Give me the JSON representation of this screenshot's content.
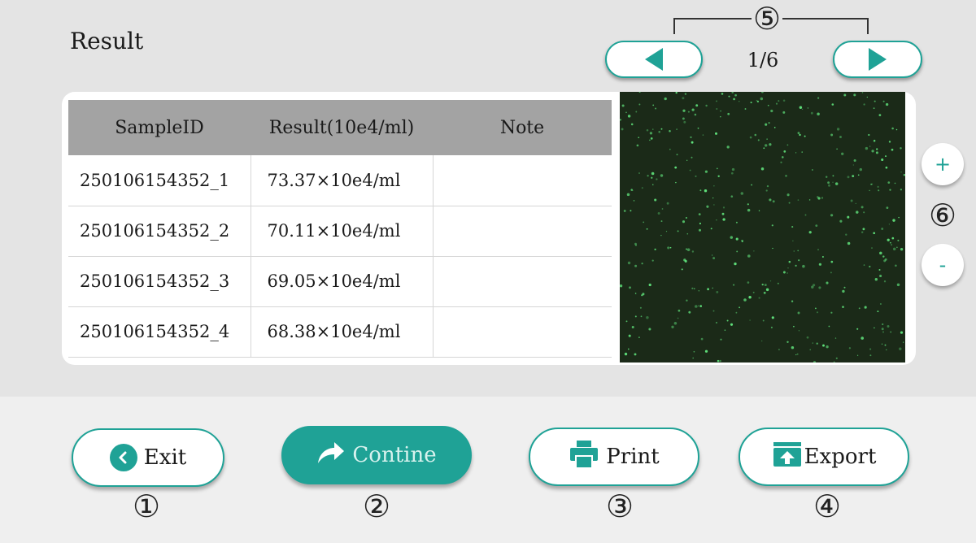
{
  "header": {
    "title": "Result"
  },
  "annotations": {
    "c1": "①",
    "c2": "②",
    "c3": "③",
    "c4": "④",
    "c5": "⑤",
    "c6": "⑥"
  },
  "pager": {
    "label": "1/6"
  },
  "zoom": {
    "in_label": "+",
    "out_label": "-"
  },
  "table": {
    "columns": [
      "SampleID",
      "Result(10e4/ml)",
      "Note"
    ],
    "rows": [
      {
        "sample_id": "250106154352_1",
        "result": "73.37×10e4/ml",
        "note": ""
      },
      {
        "sample_id": "250106154352_2",
        "result": "70.11×10e4/ml",
        "note": ""
      },
      {
        "sample_id": "250106154352_3",
        "result": "69.05×10e4/ml",
        "note": ""
      },
      {
        "sample_id": "250106154352_4",
        "result": "68.38×10e4/ml",
        "note": ""
      }
    ]
  },
  "buttons": {
    "exit": "Exit",
    "continue": "Contine",
    "print": "Print",
    "export": "Export"
  },
  "icons": {
    "prev": "triangle-left-icon",
    "next": "triangle-right-icon",
    "exit": "chevron-left-circle-icon",
    "continue": "share-arrow-icon",
    "print": "printer-icon",
    "export": "upload-box-icon"
  },
  "colors": {
    "accent": "#1fa296",
    "image_bg": "#1b2a18",
    "cell_dots": "#5fe07a"
  }
}
